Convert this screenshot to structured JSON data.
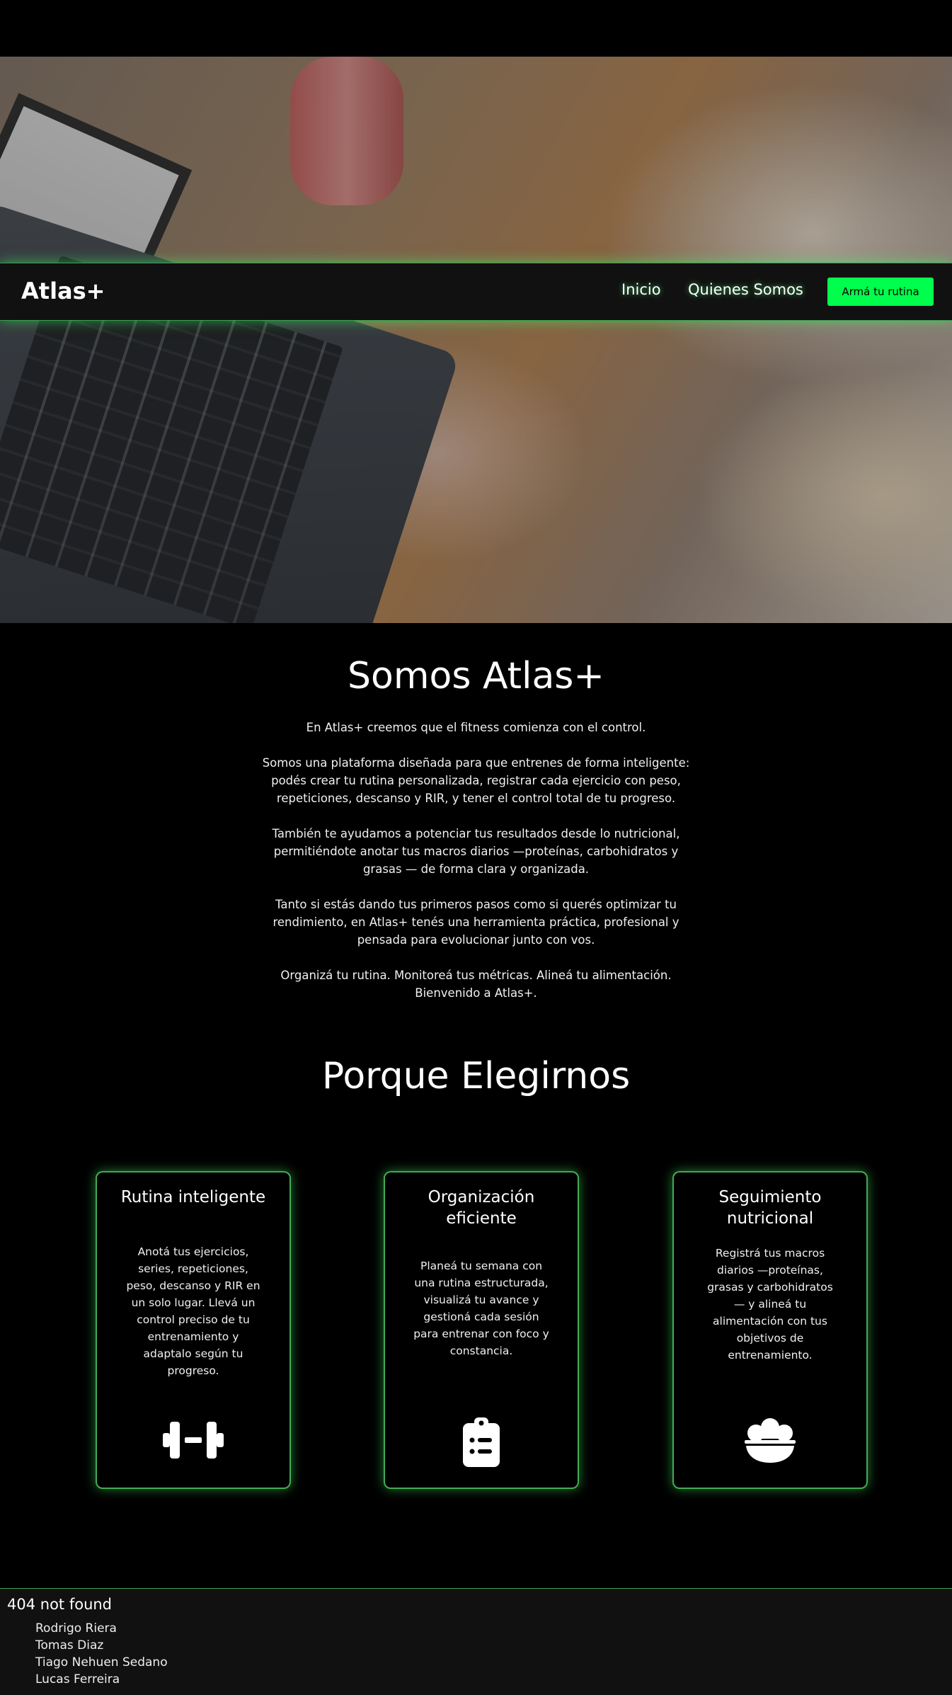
{
  "header": {
    "brand": "Atlas+",
    "nav": [
      {
        "label": "Inicio"
      },
      {
        "label": "Quienes Somos"
      }
    ],
    "cta_label": "Armá tu rutina"
  },
  "about": {
    "title": "Somos Atlas+",
    "paragraphs": [
      "En Atlas+ creemos que el fitness comienza con el control.",
      "Somos una plataforma diseñada para que entrenes de forma inteligente: podés crear tu rutina personalizada, registrar cada ejercicio con peso, repeticiones, descanso y RIR, y tener el control total de tu progreso.",
      "También te ayudamos a potenciar tus resultados desde lo nutricional, permitiéndote anotar tus macros diarios —proteínas, carbohidratos y grasas — de forma clara y organizada.",
      "Tanto si estás dando tus primeros pasos como si querés optimizar tu rendimiento, en Atlas+ tenés una herramienta práctica, profesional y pensada para evolucionar junto con vos.",
      "Organizá tu rutina. Monitoreá tus métricas. Alineá tu alimentación. Bienvenido a Atlas+."
    ]
  },
  "why": {
    "title": "Porque Elegirnos",
    "cards": [
      {
        "title": "Rutina inteligente",
        "text": "Anotá tus ejercicios, series, repeticiones, peso, descanso y RIR en un solo lugar. Llevá un control preciso de tu entrenamiento y adaptalo según tu progreso.",
        "icon": "dumbbell-icon"
      },
      {
        "title": "Organización eficiente",
        "text": "Planeá tu semana con una rutina estructurada, visualizá tu avance y gestioná cada sesión para entrenar con foco y constancia.",
        "icon": "clipboard-list-icon"
      },
      {
        "title": "Seguimiento nutricional",
        "text": "Registrá tus macros diarios —proteínas, grasas y carbohidratos — y alineá tu alimentación con tus objetivos de entrenamiento.",
        "icon": "food-bowl-icon"
      }
    ]
  },
  "footer": {
    "title": "404 not found",
    "members": [
      "Rodrigo Riera",
      "Tomas Diaz",
      "Tiago Nehuen Sedano",
      "Lucas Ferreira"
    ]
  },
  "colors": {
    "accent": "#00ff4c",
    "glow": "#3cdc5a",
    "background": "#000000",
    "surface": "#111111"
  }
}
